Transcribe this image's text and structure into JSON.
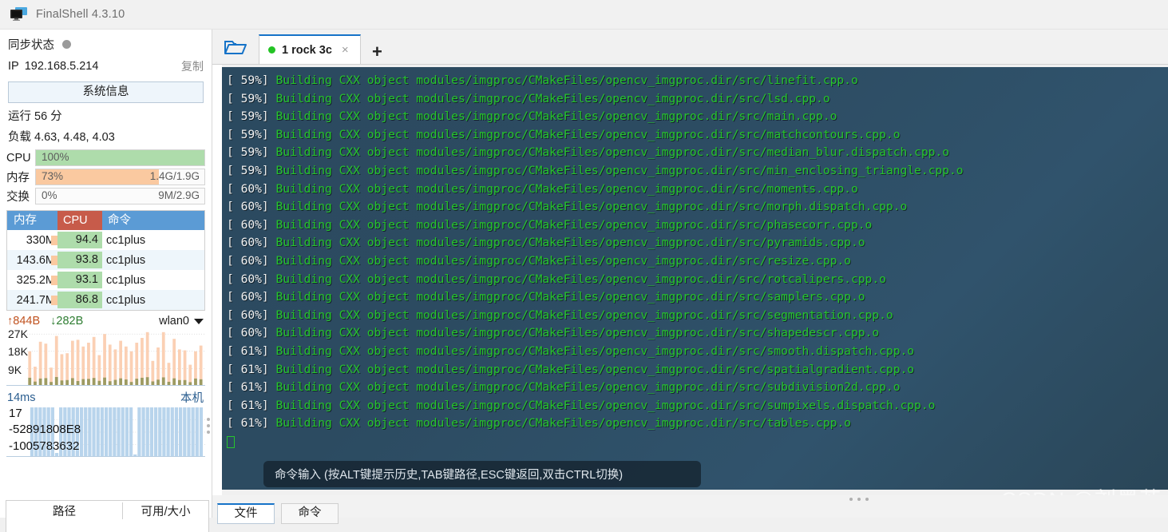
{
  "window": {
    "title": "FinalShell 4.3.10",
    "icon": "monitor-icon"
  },
  "sidebar": {
    "sync": {
      "label": "同步状态",
      "status_icon": "status-dot"
    },
    "ip": {
      "label": "IP",
      "value": "192.168.5.214",
      "copy_label": "复制"
    },
    "system_info_button": "系统信息",
    "uptime": "运行 56 分",
    "load": "负载 4.63, 4.48, 4.03",
    "resources": [
      {
        "name": "CPU",
        "percent_label": "100%",
        "percent": 100,
        "detail": "",
        "fill_color": "#aedcab"
      },
      {
        "name": "内存",
        "percent_label": "73%",
        "percent": 73,
        "detail": "1.4G/1.9G",
        "fill_color": "#fac9a0"
      },
      {
        "name": "交换",
        "percent_label": "0%",
        "percent": 0,
        "detail": "9M/2.9G",
        "fill_color": "#fac9a0"
      }
    ],
    "process_table": {
      "headers": {
        "mem": "内存",
        "cpu": "CPU",
        "cmd": "命令"
      },
      "header_colors": {
        "mem": "#5b9bd5",
        "cpu": "#c75b4a",
        "cmd": "#5b9bd5"
      },
      "rows": [
        {
          "mem": "330M",
          "cpu": "94.4",
          "cmd": "cc1plus"
        },
        {
          "mem": "143.6M",
          "cpu": "93.8",
          "cmd": "cc1plus"
        },
        {
          "mem": "325.2M",
          "cpu": "93.1",
          "cmd": "cc1plus"
        },
        {
          "mem": "241.7M",
          "cpu": "86.8",
          "cmd": "cc1plus"
        }
      ]
    },
    "network": {
      "upload": "844B",
      "download": "282B",
      "interface": "wlan0",
      "up_arrow": "↑",
      "down_arrow": "↓",
      "y_labels": [
        "27K",
        "18K",
        "9K"
      ]
    },
    "latency": {
      "value": "14ms",
      "host_label": "本机",
      "overlay_labels": [
        "17",
        "-52891808E8",
        "-1005783632"
      ]
    },
    "file_panel": {
      "columns": [
        "路径",
        "可用/大小"
      ]
    }
  },
  "tabbar": {
    "folder_icon": "open-folder-icon",
    "tabs": [
      {
        "label": "1 rock 3c",
        "status": "connected",
        "close_icon": "×"
      }
    ],
    "new_tab_icon": "+"
  },
  "terminal": {
    "prefix_build": "Building CXX object ",
    "path_prefix": "modules/imgproc/CMakeFiles/opencv_imgproc.dir/src/",
    "lines": [
      {
        "percent": "[ 59%]",
        "file": "linefit.cpp.o"
      },
      {
        "percent": "[ 59%]",
        "file": "lsd.cpp.o"
      },
      {
        "percent": "[ 59%]",
        "file": "main.cpp.o"
      },
      {
        "percent": "[ 59%]",
        "file": "matchcontours.cpp.o"
      },
      {
        "percent": "[ 59%]",
        "file": "median_blur.dispatch.cpp.o"
      },
      {
        "percent": "[ 59%]",
        "file": "min_enclosing_triangle.cpp.o"
      },
      {
        "percent": "[ 60%]",
        "file": "moments.cpp.o"
      },
      {
        "percent": "[ 60%]",
        "file": "morph.dispatch.cpp.o"
      },
      {
        "percent": "[ 60%]",
        "file": "phasecorr.cpp.o"
      },
      {
        "percent": "[ 60%]",
        "file": "pyramids.cpp.o"
      },
      {
        "percent": "[ 60%]",
        "file": "resize.cpp.o"
      },
      {
        "percent": "[ 60%]",
        "file": "rotcalipers.cpp.o"
      },
      {
        "percent": "[ 60%]",
        "file": "samplers.cpp.o"
      },
      {
        "percent": "[ 60%]",
        "file": "segmentation.cpp.o"
      },
      {
        "percent": "[ 60%]",
        "file": "shapedescr.cpp.o"
      },
      {
        "percent": "[ 61%]",
        "file": "smooth.dispatch.cpp.o"
      },
      {
        "percent": "[ 61%]",
        "file": "spatialgradient.cpp.o"
      },
      {
        "percent": "[ 61%]",
        "file": "subdivision2d.cpp.o"
      },
      {
        "percent": "[ 61%]",
        "file": "sumpixels.dispatch.cpp.o"
      },
      {
        "percent": "[ 61%]",
        "file": "tables.cpp.o"
      }
    ],
    "command_input_placeholder": "命令输入 (按ALT键提示历史,TAB键路径,ESC键返回,双击CTRL切换)",
    "colors": {
      "text": "#26c52c",
      "percent": "#f2f2f2",
      "background": "#2c4b61"
    }
  },
  "bottom_tabs": [
    {
      "label": "文件",
      "active": true
    },
    {
      "label": "命令",
      "active": false
    }
  ],
  "watermark": "CSDN @刘墨苏",
  "chart_data": [
    {
      "type": "bar",
      "title": "network-traffic",
      "ylabel": "",
      "ytick_labels": [
        "27K",
        "18K",
        "9K"
      ],
      "ylim": [
        0,
        30000
      ],
      "series": [
        {
          "name": "upload",
          "color": "#fbd0b4",
          "values": [
            18000,
            10000,
            23000,
            22000,
            9500,
            26000,
            16500,
            17000,
            23500,
            24000,
            20500,
            22500,
            25500,
            16000,
            27000,
            21500,
            19000,
            23500,
            20500,
            18000,
            22500,
            25000,
            28000,
            13000,
            20000,
            28000,
            12000,
            24500,
            19000,
            18500,
            11000,
            18000,
            21000
          ]
        },
        {
          "name": "download",
          "color": "#9d9b62",
          "values": [
            4200,
            2200,
            3800,
            4000,
            2000,
            4600,
            2800,
            3000,
            4000,
            2500,
            3500,
            3600,
            4100,
            2600,
            4300,
            2400,
            3100,
            3900,
            3300,
            2000,
            3700,
            4200,
            4500,
            2300,
            3200,
            4400,
            2100,
            3900,
            3000,
            3000,
            1900,
            3800,
            3400
          ]
        }
      ]
    },
    {
      "type": "area",
      "title": "latency",
      "ylabel": "",
      "value_label": "14ms",
      "color": "#b8d4ec",
      "values": [
        1,
        1,
        1,
        1,
        1,
        1,
        0.08,
        1,
        1,
        1,
        1,
        1,
        1,
        1,
        1,
        1,
        1,
        1,
        1,
        1,
        1,
        1,
        1,
        1,
        1,
        0.05,
        1,
        1,
        1,
        1,
        1,
        1,
        1,
        1,
        1,
        1,
        1,
        1,
        1,
        1,
        1,
        1
      ]
    }
  ]
}
